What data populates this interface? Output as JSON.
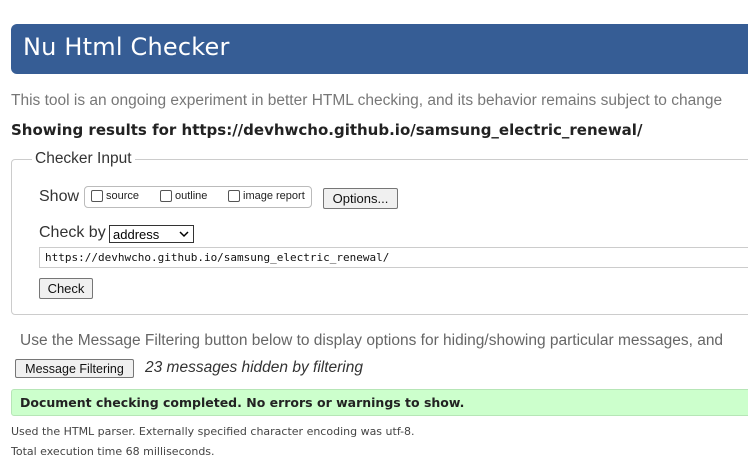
{
  "header": {
    "title": "Nu Html Checker"
  },
  "intro": "This tool is an ongoing experiment in better HTML checking, and its behavior remains subject to change",
  "showing": "Showing results for https://devhwcho.github.io/samsung_electric_renewal/",
  "checker_input": {
    "legend": "Checker Input",
    "show_label": "Show",
    "options": [
      {
        "label": "source",
        "checked": false
      },
      {
        "label": "outline",
        "checked": false
      },
      {
        "label": "image report",
        "checked": false
      }
    ],
    "options_button": "Options...",
    "check_by_label": "Check by",
    "check_by_value": "address",
    "url_value": "https://devhwcho.github.io/samsung_electric_renewal/",
    "check_button": "Check"
  },
  "filter": {
    "note": "Use the Message Filtering button below to display options for hiding/showing particular messages, and",
    "button": "Message Filtering",
    "hidden_count": "23 messages hidden by filtering"
  },
  "result": {
    "success": "Document checking completed. No errors or warnings to show.",
    "parser_note": "Used the HTML parser. Externally specified character encoding was utf-8.",
    "execution_time": "Total execution time 68 milliseconds."
  },
  "colors": {
    "header_bg": "#365d95",
    "success_bg": "#ccffcc"
  }
}
